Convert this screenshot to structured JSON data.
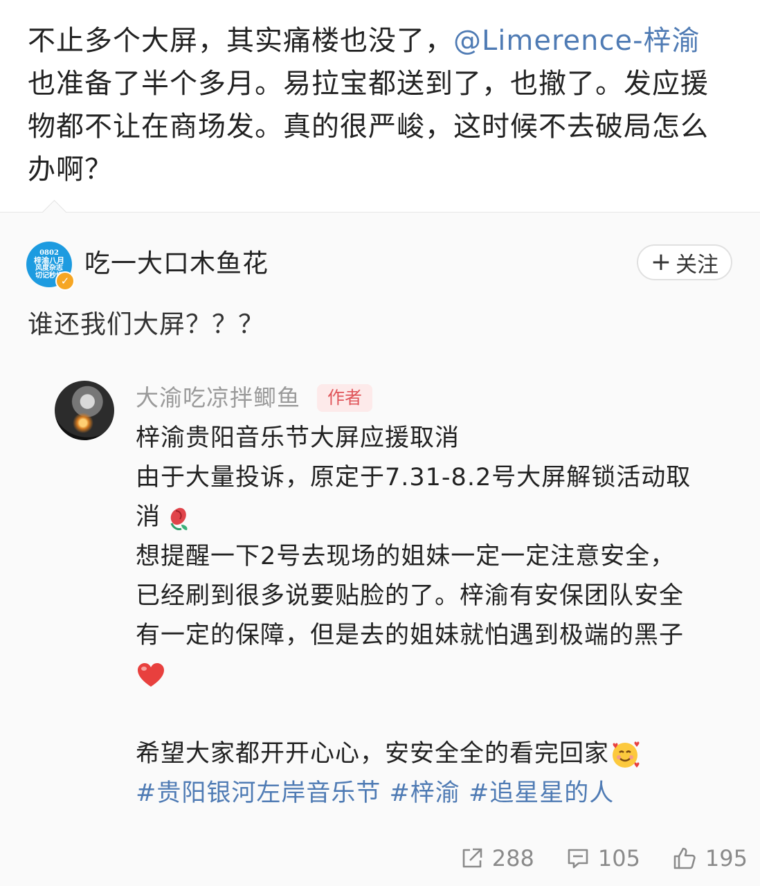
{
  "post": {
    "text_before_mention": "不止多个大屏，其实痛楼也没了，",
    "mention": "@Limerence-梓渝",
    "text_after_mention": "也准备了半个多月。易拉宝都送到了，也撤了。发应援物都不让在商场发。真的很严峻，这时候不去破局怎么办啊？"
  },
  "repost": {
    "avatar_text": [
      "0802",
      "梓渝八月",
      "风度杂志",
      "切记秒切"
    ],
    "username": "吃一大口木鱼花",
    "follow_label": "关注",
    "text": "谁还我们大屏？？？"
  },
  "original": {
    "username": "大渝吃凉拌鲫鱼",
    "author_badge": "作者",
    "lines": [
      "梓渝贵阳音乐节大屏应援取消",
      "由于大量投诉，原定于7.31-8.2号大屏解锁活动取",
      "消",
      "想提醒一下2号去现场的姐妹一定一定注意安全，",
      "已经刷到很多说要贴脸的了。梓渝有安保团队安全",
      "有一定的保障，但是去的姐妹就怕遇到极端的黑子",
      "希望大家都开开心心，安安全全的看完回家"
    ],
    "topics": [
      "#贵阳银河左岸音乐节",
      "#梓渝",
      "#追星星的人"
    ]
  },
  "stats": {
    "reposts": "288",
    "comments": "105",
    "likes": "195"
  },
  "icons": {
    "repost": "share-icon",
    "comment": "comment-icon",
    "like": "thumbs-up-icon",
    "verified": "verified-badge-icon",
    "emoji_1": "wilted-rose-emoji",
    "emoji_2": "red-heart-emoji",
    "emoji_3": "smiling-face-with-hearts-emoji"
  },
  "colors": {
    "link": "#4f7bb4",
    "author_badge_bg": "#fdeaea",
    "author_badge_text": "#e0555a",
    "quoted_bg": "#fafafa"
  }
}
